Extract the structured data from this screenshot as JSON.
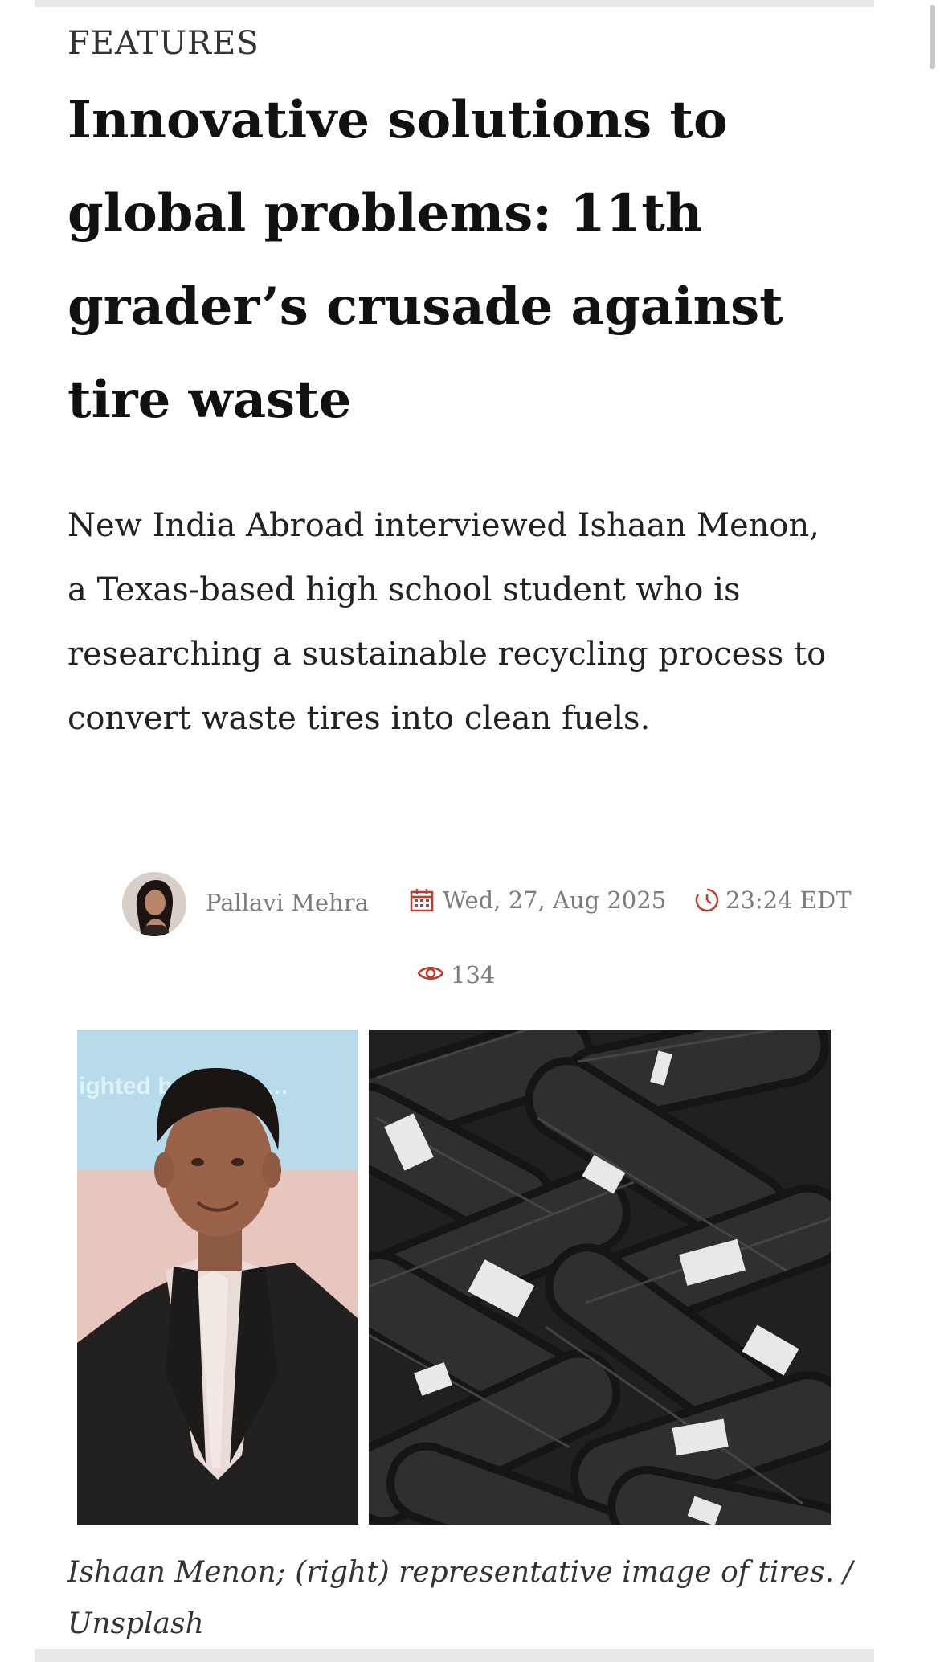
{
  "article": {
    "section": "FEATURES",
    "headline": "Innovative solutions to global problems: 11th grader’s crusade against tire waste",
    "dek": "New India Abroad interviewed Ishaan Menon, a Texas-based high school student who is researching a sustainable recycling process to convert waste tires into clean fuels.",
    "author": "Pallavi Mehra",
    "date": "Wed, 27, Aug 2025",
    "time": "23:24 EDT",
    "views": "134",
    "caption": "Ishaan Menon; (right) representative image of tires. / Unsplash"
  },
  "image_overlay_text": "ighted b… wer a…",
  "colors": {
    "accent": "#c0392b",
    "meta": "#7c7c7c",
    "scroll_track": "#e9e9e9"
  },
  "icons": {
    "date": "calendar-icon",
    "time": "clock-icon",
    "views": "eye-icon"
  }
}
